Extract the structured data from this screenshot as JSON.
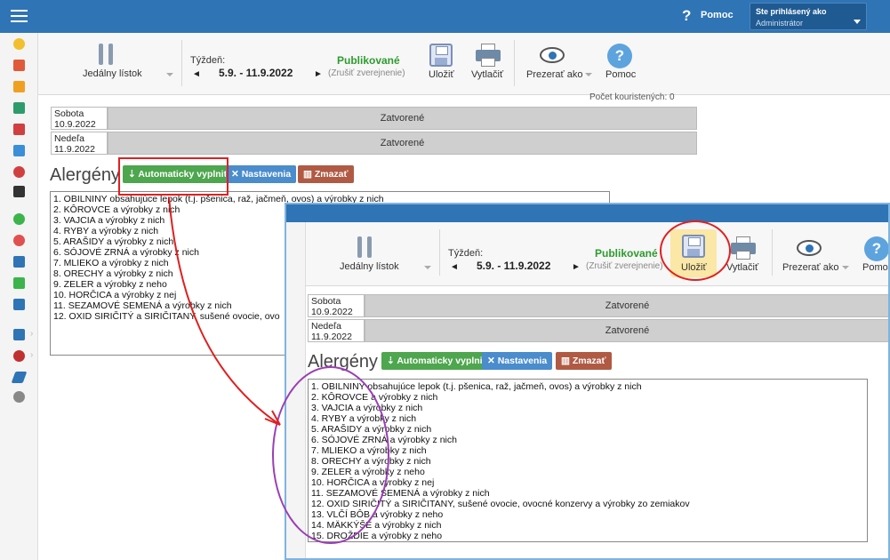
{
  "header": {
    "help_glyph": "?",
    "help_label": "Pomoc",
    "user_line1": "Ste prihlásený ako",
    "user_line2": "Administrátor"
  },
  "toolbar": {
    "menu_label": "Jedálny lístok",
    "week_label": "Týždeň:",
    "week_prev": "◄",
    "week_range": "5.9. - 11.9.2022",
    "week_next": "►",
    "status": "Publikované",
    "unpublish": "(Zrušiť zverejnenie)",
    "save": "Uložiť",
    "print": "Vytlačiť",
    "preview": "Prezerať ako",
    "help": "Pomoc",
    "help_glyph": "?"
  },
  "partial_row_text": "Počet kouristených: 0",
  "days": [
    {
      "name": "Sobota",
      "date": "10.9.2022",
      "status": "Zatvorené"
    },
    {
      "name": "Nedeľa",
      "date": "11.9.2022",
      "status": "Zatvorené"
    }
  ],
  "allergens": {
    "title": "Alergény",
    "autofill": "Automaticky vyplniť",
    "settings": "Nastavenia",
    "delete": "Zmazať",
    "lines_short": [
      "1. OBILNINY obsahujúce lepok (t.j. pšenica, raž, jačmeň, ovos) a výrobky z nich",
      "2. KÔROVCE a výrobky z nich",
      "3. VAJCIA a výrobky z nich",
      "4. RYBY a výrobky z nich",
      "5. ARAŠIDY a výrobky z nich",
      "6. SÓJOVÉ ZRNÁ a výrobky z nich",
      "7. MLIEKO a výrobky z nich",
      "8. ORECHY a výrobky z nich",
      "9. ZELER a výrobky z neho",
      "10. HORČICA a výrobky z nej",
      "11. SEZAMOVÉ SEMENÁ a výrobky z nich",
      "12. OXID SIRIČITÝ a SIRIČITANY, sušené ovocie, ovo"
    ],
    "lines_full": [
      "1. OBILNINY obsahujúce lepok (t.j. pšenica, raž, jačmeň, ovos) a výrobky z nich",
      "2. KÔROVCE a výrobky z nich",
      "3. VAJCIA a výrobky z nich",
      "4. RYBY a výrobky z nich",
      "5. ARAŠIDY a výrobky z nich",
      "6. SÓJOVÉ ZRNÁ a výrobky z nich",
      "7. MLIEKO a výrobky z nich",
      "8. ORECHY a výrobky z nich",
      "9. ZELER a výrobky z neho",
      "10. HORČICA a výrobky z nej",
      "11. SEZAMOVÉ SEMENÁ a výrobky z nich",
      "12. OXID SIRIČITÝ a SIRIČITANY, sušené ovocie, ovocné konzervy a výrobky zo zemiakov",
      "13. VLČÍ BÔB a výrobky z neho",
      "14. MÄKKÝŠE a výrobky z nich",
      "15. DROŽDIE a výrobky z neho"
    ]
  },
  "colors": {
    "topbar": "#2f74b5",
    "published": "#2e9b2e",
    "annotation_red": "#e02020",
    "annotation_purple": "#9b3fb5"
  }
}
